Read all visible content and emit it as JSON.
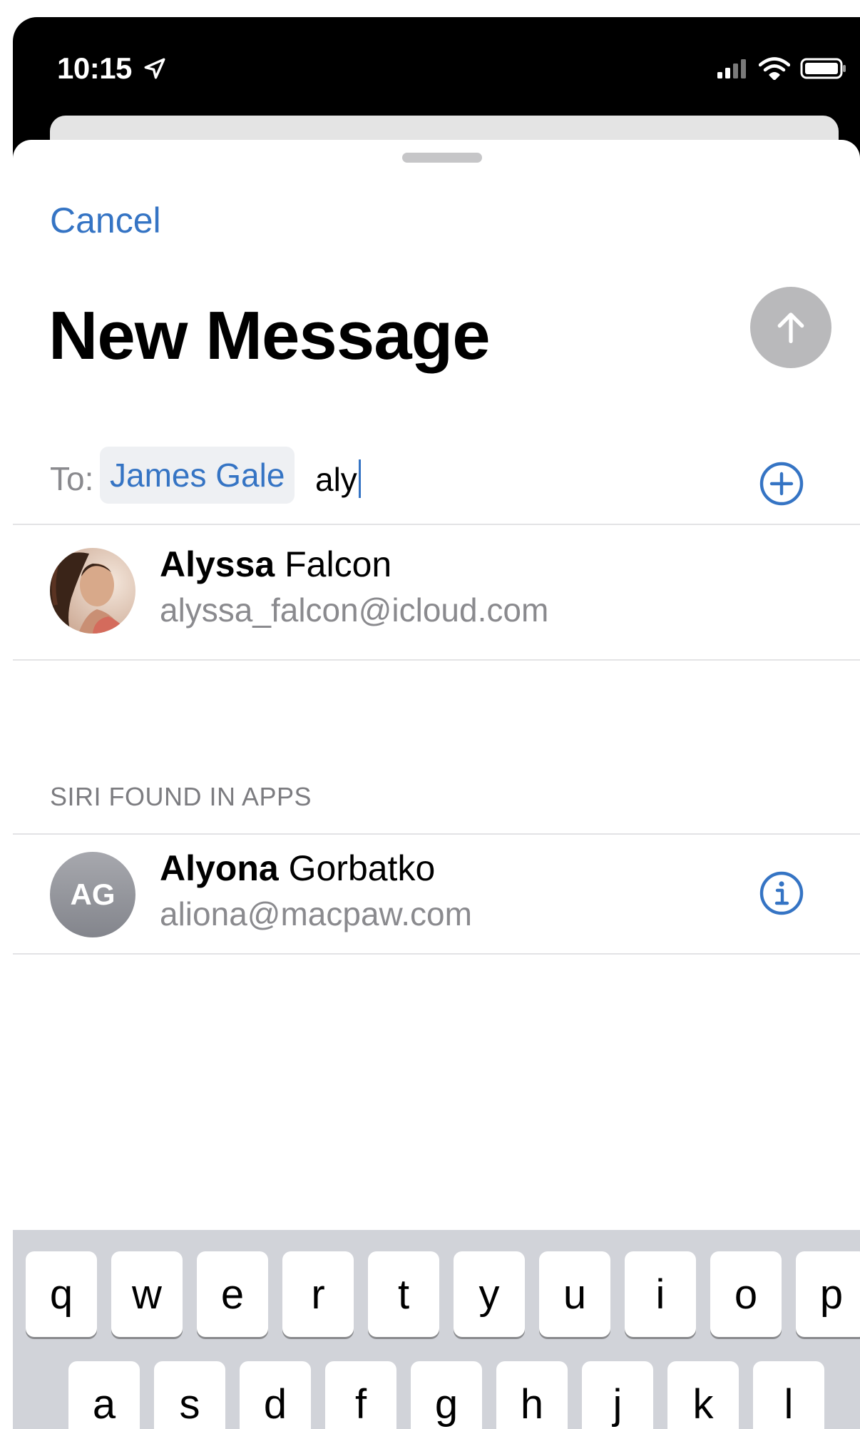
{
  "status_bar": {
    "time": "10:15",
    "icons": [
      "location-arrow-icon",
      "signal-icon",
      "wifi-icon",
      "battery-icon"
    ]
  },
  "header": {
    "cancel_label": "Cancel",
    "title": "New Message",
    "send_icon": "arrow-up-icon"
  },
  "to_field": {
    "label": "To:",
    "recipient_chip": "James Gale",
    "typed_text": "aly",
    "add_icon": "plus-circle-icon"
  },
  "contacts": [
    {
      "name_bold": "Alyssa",
      "name_rest": " Falcon",
      "email": "alyssa_falcon@icloud.com",
      "avatar": "photo"
    }
  ],
  "siri_section": {
    "header": "SIRI FOUND IN APPS",
    "contacts": [
      {
        "initials": "AG",
        "name_bold": "Alyona",
        "name_rest": " Gorbatko",
        "email": "aliona@macpaw.com",
        "info_icon": "info-circle-icon"
      }
    ]
  },
  "keyboard": {
    "row1": [
      "q",
      "w",
      "e",
      "r",
      "t",
      "y",
      "u",
      "i",
      "o",
      "p"
    ],
    "row2": [
      "a",
      "s",
      "d",
      "f",
      "g",
      "h",
      "j",
      "k",
      "l"
    ]
  },
  "colors": {
    "accent": "#3574c4",
    "secondary_text": "#8a8a8e",
    "keyboard_bg": "#d1d3d9",
    "send_disabled": "#b9b9bb"
  }
}
